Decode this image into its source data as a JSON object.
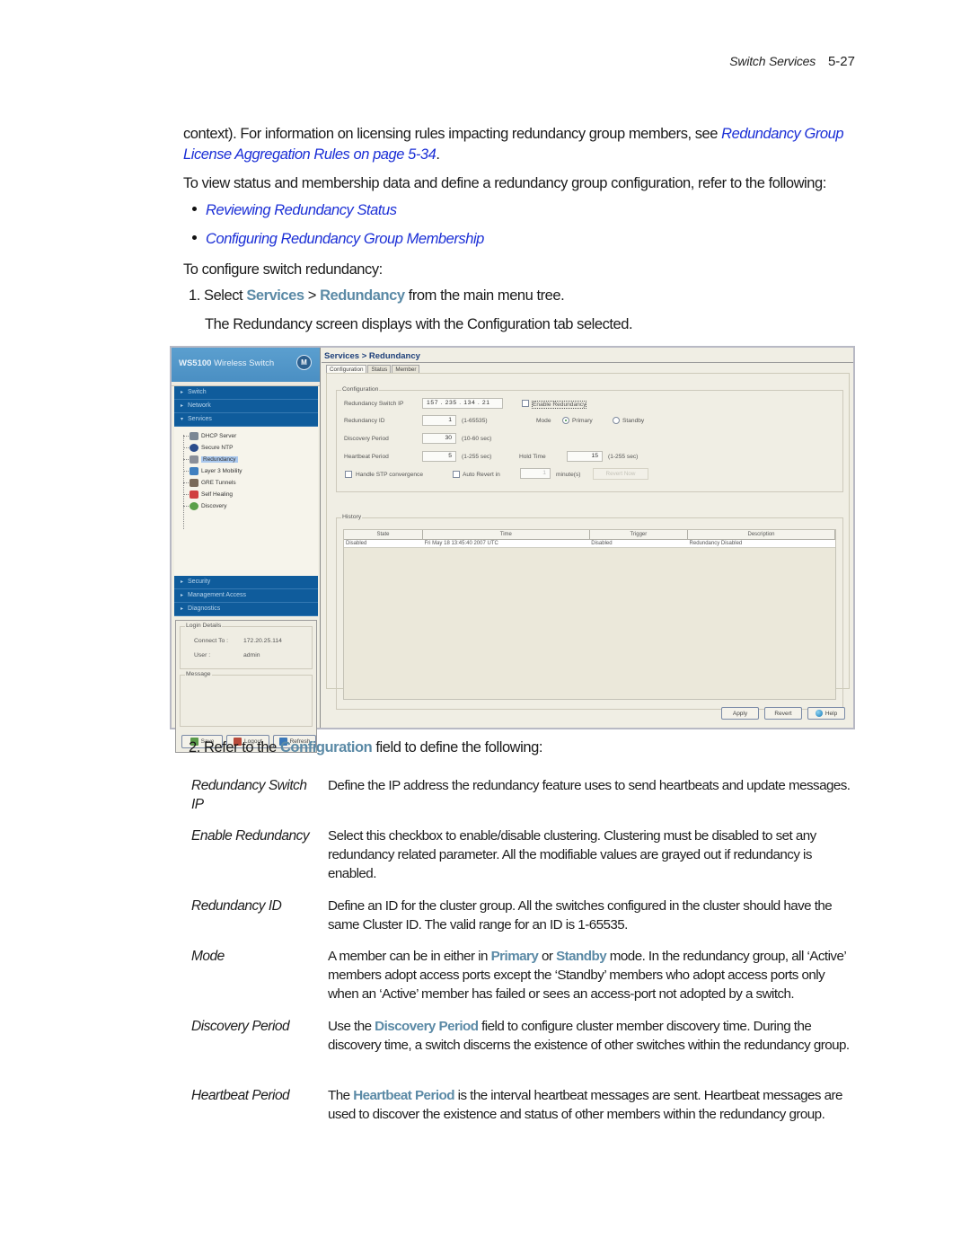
{
  "running_header": {
    "section": "Switch Services",
    "page": "5-27"
  },
  "intro": {
    "para1_text": "context). For information on licensing rules impacting redundancy group members, see ",
    "para1_link": "Redundancy Group License Aggregation Rules on page 5-34",
    "para1_end": ".",
    "para2": "To view status and membership data and define a redundancy group configuration, refer to the following:",
    "bullets": [
      "Reviewing Redundancy Status",
      "Configuring Redundancy Group Membership"
    ],
    "para3": "To configure switch redundancy:"
  },
  "step1": {
    "number": "1.",
    "pre": "Select ",
    "ref1": "Services",
    "sep": " > ",
    "ref2": "Redundancy",
    "post": " from the main menu tree.",
    "note": "The Redundancy screen displays with the Configuration tab selected."
  },
  "screenshot": {
    "brand": {
      "model": "WS5100",
      "product": " Wireless Switch",
      "logo": "M"
    },
    "nav_top": [
      {
        "label": "Switch",
        "caret": "▸"
      },
      {
        "label": "Network",
        "caret": "▸"
      },
      {
        "label": "Services",
        "caret": "▾"
      }
    ],
    "tree": [
      {
        "label": "DHCP Server",
        "icon": "server-icon",
        "color": "#7b8794"
      },
      {
        "label": "Secure NTP",
        "icon": "clock-icon",
        "color": "#2a4c8c"
      },
      {
        "label": "Redundancy",
        "icon": "redundancy-icon",
        "color": "#8a8f99",
        "selected": true
      },
      {
        "label": "Layer 3 Mobility",
        "icon": "mobility-icon",
        "color": "#3f7fbf"
      },
      {
        "label": "GRE Tunnels",
        "icon": "tunnel-icon",
        "color": "#7a6a5a"
      },
      {
        "label": "Self Healing",
        "icon": "healing-icon",
        "color": "#d04040"
      },
      {
        "label": "Discovery",
        "icon": "discovery-icon",
        "color": "#5aa04a"
      }
    ],
    "nav_bottom": [
      {
        "label": "Security",
        "caret": "▸"
      },
      {
        "label": "Management Access",
        "caret": "▸"
      },
      {
        "label": "Diagnostics",
        "caret": "▸"
      }
    ],
    "login": {
      "legend": "Login Details",
      "connect_label": "Connect To :",
      "connect_value": "172.20.25.114",
      "user_label": "User :",
      "user_value": "admin",
      "message_legend": "Message"
    },
    "side_buttons": [
      "Save",
      "Logout",
      "Refresh"
    ],
    "title": "Services > Redundancy",
    "tabs": [
      {
        "label": "Configuration",
        "active": true
      },
      {
        "label": "Status",
        "active": false
      },
      {
        "label": "Member",
        "active": false
      }
    ],
    "config": {
      "legend": "Configuration",
      "switch_ip_label": "Redundancy Switch IP",
      "switch_ip_value": "157 . 235 . 134 . 21",
      "enable_label": "Enable Redundancy",
      "enable_checked": false,
      "id_label": "Redundancy ID",
      "id_value": "1",
      "id_range": "(1-65535)",
      "mode_label": "Mode",
      "mode_options": [
        "Primary",
        "Standby"
      ],
      "mode_selected": "Primary",
      "discovery_label": "Discovery Period",
      "discovery_value": "30",
      "discovery_range": "(10-60 sec)",
      "heartbeat_label": "Heartbeat Period",
      "heartbeat_value": "5",
      "heartbeat_range": "(1-255 sec)",
      "hold_label": "Hold Time",
      "hold_value": "15",
      "hold_range": "(1-255 sec)",
      "stp_label": "Handle STP convergence",
      "auto_revert_label": "Auto Revert in",
      "auto_revert_value": "1",
      "auto_revert_unit": "minute(s)",
      "revert_now_label": "Revert Now"
    },
    "history": {
      "legend": "History",
      "columns": [
        "State",
        "Time",
        "Trigger",
        "Description"
      ],
      "rows": [
        [
          "Disabled",
          "Fri May 18 13:45:40 2007 UTC",
          "Disabled",
          "Redundancy Disabled"
        ]
      ]
    },
    "action_buttons": {
      "apply": "Apply",
      "revert": "Revert",
      "help": "Help"
    }
  },
  "step2": {
    "number": "2.",
    "pre": "Refer to the ",
    "ref": "Configuration",
    "post": " field to define the following:"
  },
  "definitions": [
    {
      "term": "Redundancy Switch IP",
      "desc": [
        {
          "t": "Define the IP address the redundancy feature uses to send heartbeats and update messages."
        }
      ]
    },
    {
      "term": "Enable Redundancy",
      "desc": [
        {
          "t": "Select this checkbox to enable/disable clustering. Clustering must be disabled to set any redundancy related parameter. All the modifiable values are grayed out if redundancy is enabled."
        }
      ]
    },
    {
      "term": "Redundancy ID",
      "desc": [
        {
          "t": "Define an ID for the cluster group. All the switches configured in the cluster should have the same Cluster ID. The valid range for an ID is 1-65535."
        }
      ]
    },
    {
      "term": "Mode",
      "desc": [
        {
          "t": "A member can be in either in "
        },
        {
          "b": "Primary"
        },
        {
          "t": " or "
        },
        {
          "b": "Standby"
        },
        {
          "t": " mode. In the redundancy group, all ‘Active’ members adopt access ports except the ‘Standby’ members who adopt access ports only when an ‘Active’ member has failed or sees an access-port not adopted by a switch."
        }
      ]
    },
    {
      "term": "Discovery Period",
      "desc": [
        {
          "t": "Use the "
        },
        {
          "b": "Discovery Period"
        },
        {
          "t": " field to configure cluster member discovery time. During the discovery time, a switch discerns the existence of other switches within the redundancy group."
        }
      ]
    },
    {
      "term": "Heartbeat Period",
      "desc": [
        {
          "t": "The "
        },
        {
          "b": "Heartbeat Period"
        },
        {
          "t": " is the interval heartbeat messages are sent. Heartbeat messages are used to discover the existence and status of other members within the redundancy group."
        }
      ]
    }
  ]
}
